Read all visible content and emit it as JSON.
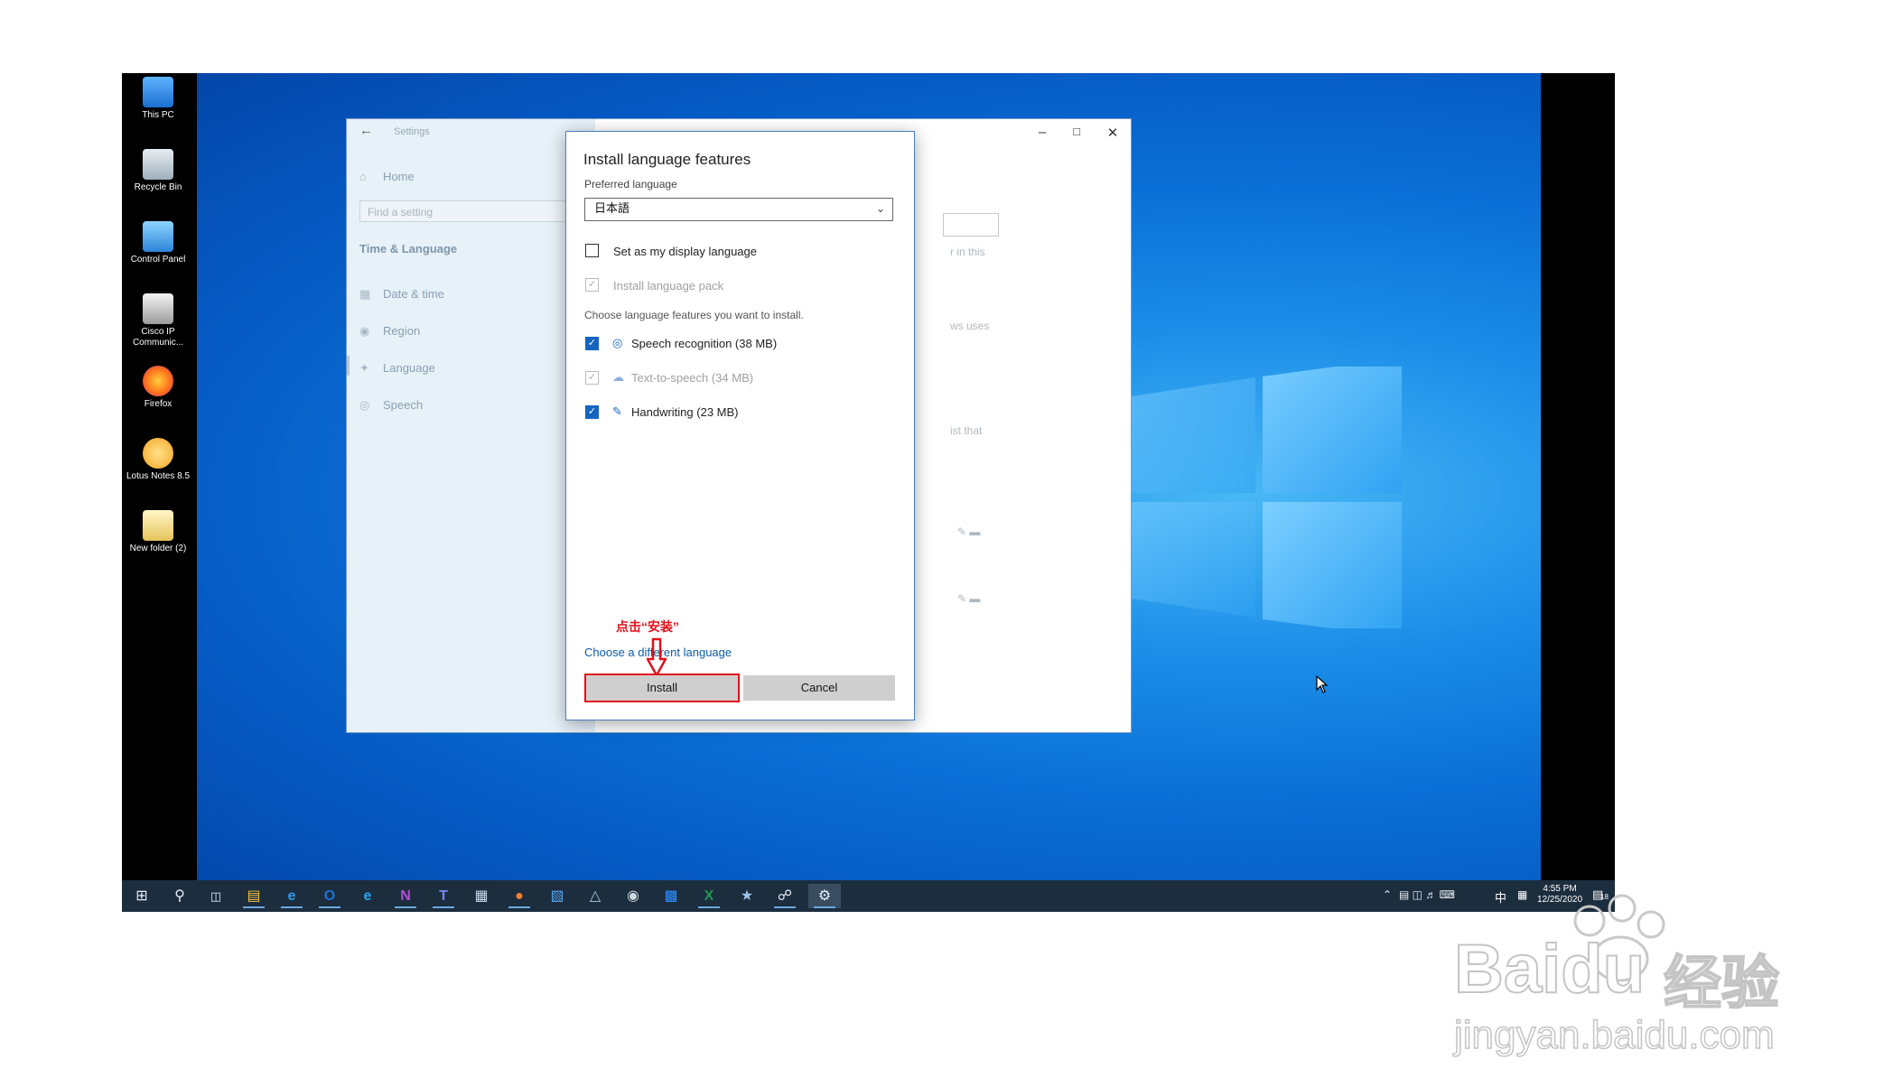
{
  "desktop": {
    "icons": [
      {
        "label": "This PC",
        "icon": "computer-icon"
      },
      {
        "label": "Recycle Bin",
        "icon": "recycle-bin-icon"
      },
      {
        "label": "Control Panel",
        "icon": "control-panel-icon"
      },
      {
        "label": "Cisco IP Communic...",
        "icon": "cisco-ip-communicator-icon"
      },
      {
        "label": "Firefox",
        "icon": "firefox-icon"
      },
      {
        "label": "Lotus Notes 8.5",
        "icon": "lotus-notes-icon"
      },
      {
        "label": "New folder (2)",
        "icon": "folder-icon"
      }
    ]
  },
  "settings": {
    "title": "Settings",
    "home": "Home",
    "search_placeholder": "Find a setting",
    "section": "Time & Language",
    "nav": [
      {
        "label": "Date & time",
        "icon": "calendar-clock-icon"
      },
      {
        "label": "Region",
        "icon": "globe-icon"
      },
      {
        "label": "Language",
        "icon": "language-icon"
      },
      {
        "label": "Speech",
        "icon": "microphone-icon"
      }
    ],
    "background_fragments": [
      "r in this",
      "ws uses",
      "ist that"
    ]
  },
  "dialog": {
    "title": "Install language features",
    "preferred_label": "Preferred language",
    "preferred_value": "日本語",
    "display_language": {
      "label": "Set as my display language",
      "checked": false
    },
    "language_pack": {
      "label": "Install language pack",
      "checked": true,
      "disabled": true
    },
    "choose_label": "Choose language features you want to install.",
    "features": [
      {
        "label": "Speech recognition (38 MB)",
        "checked": true,
        "disabled": false,
        "icon": "microphone-icon"
      },
      {
        "label": "Text-to-speech (34 MB)",
        "checked": true,
        "disabled": true,
        "icon": "speech-bubble-icon"
      },
      {
        "label": "Handwriting (23 MB)",
        "checked": true,
        "disabled": false,
        "icon": "pen-icon"
      }
    ],
    "different_language_link": "Choose a different language",
    "install_label": "Install",
    "cancel_label": "Cancel",
    "annotation": "点击“安装”"
  },
  "taskbar": {
    "apps": [
      "start-icon",
      "search-icon",
      "task-view-icon",
      "file-explorer-icon",
      "edge-legacy-icon",
      "outlook-icon",
      "edge-icon",
      "onenote-icon",
      "teams-icon",
      "word-icon",
      "firefox-icon",
      "people-icon",
      "app-icon",
      "chrome-icon",
      "zoom-icon",
      "excel-icon",
      "network-icon",
      "cisco-icon",
      "settings-icon"
    ],
    "ime": "中",
    "time": "4:55 PM",
    "date": "12/25/2020",
    "notification_badge": "18"
  },
  "watermark": {
    "brand": "Bai",
    "brand2": "du",
    "cn": "经验",
    "url": "jingyan.baidu.com"
  }
}
